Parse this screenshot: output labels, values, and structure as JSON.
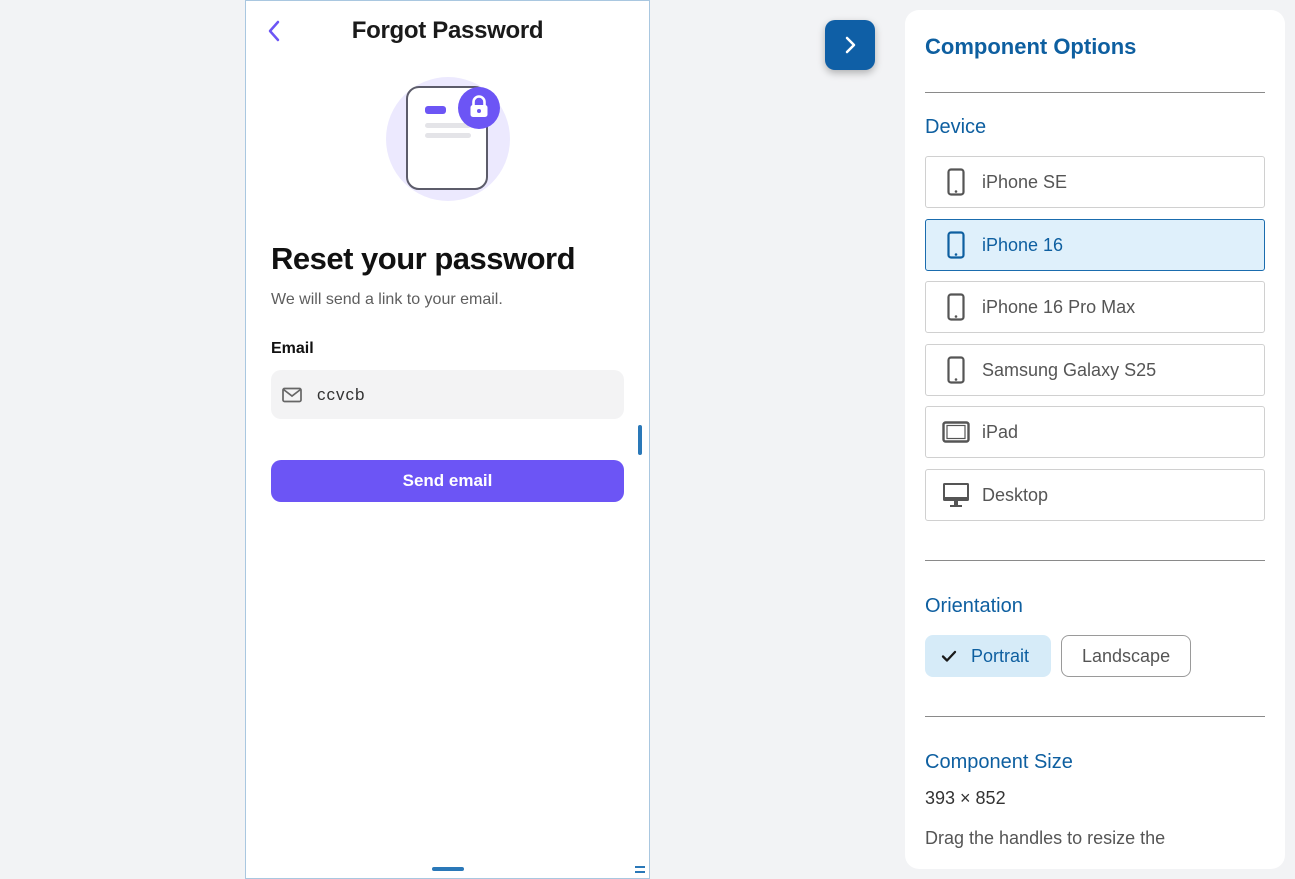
{
  "phone": {
    "title": "Forgot Password",
    "reset_title": "Reset your password",
    "reset_subtitle": "We will send a link to your email.",
    "email_label": "Email",
    "email_value": "ccvcb",
    "send_button": "Send email"
  },
  "panel": {
    "title": "Component Options",
    "device_section": "Device",
    "devices": [
      {
        "label": "iPhone SE",
        "icon": "phone-icon",
        "selected": false
      },
      {
        "label": "iPhone 16",
        "icon": "phone-icon",
        "selected": true
      },
      {
        "label": "iPhone 16 Pro Max",
        "icon": "phone-icon",
        "selected": false
      },
      {
        "label": "Samsung Galaxy S25",
        "icon": "phone-icon",
        "selected": false
      },
      {
        "label": "iPad",
        "icon": "tablet-icon",
        "selected": false
      },
      {
        "label": "Desktop",
        "icon": "desktop-icon",
        "selected": false
      }
    ],
    "orientation_section": "Orientation",
    "orientation": {
      "portrait": "Portrait",
      "landscape": "Landscape",
      "selected": "portrait"
    },
    "size_section": "Component Size",
    "size_value": "393 × 852",
    "size_hint": "Drag the handles to resize the"
  },
  "colors": {
    "accent_purple": "#6c55f5",
    "panel_blue": "#0e5fa0",
    "selected_bg": "#dff0fb"
  }
}
